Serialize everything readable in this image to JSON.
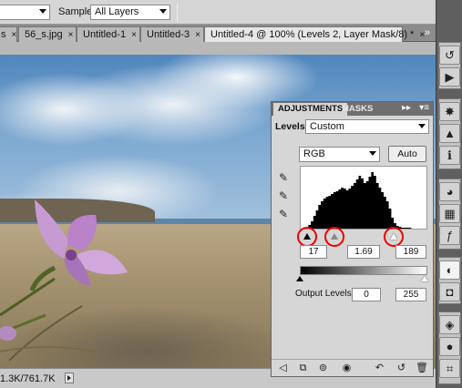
{
  "options_bar": {
    "sample_label": "Sample:",
    "sample_value": "All Layers"
  },
  "tabs": [
    {
      "label": "s",
      "active": false
    },
    {
      "label": "56_s.jpg",
      "active": false
    },
    {
      "label": "Untitled-1",
      "active": false
    },
    {
      "label": "Untitled-3",
      "active": false
    },
    {
      "label": "Untitled-4 @ 100% (Levels 2, Layer Mask/8) *",
      "active": true
    }
  ],
  "tab_more": "»",
  "status_bar": {
    "doc_size": "1.3K/761.7K"
  },
  "adjustments_panel": {
    "tabs": [
      "ADJUSTMENTS",
      "MASKS"
    ],
    "levels_label": "Levels",
    "preset_value": "Custom",
    "channel_value": "RGB",
    "auto_label": "Auto",
    "input_levels": {
      "black": "17",
      "gamma": "1.69",
      "white": "189"
    },
    "output_levels_label": "Output Levels:",
    "output_levels": {
      "black": "0",
      "white": "255"
    },
    "highlight_color": "#e00000"
  },
  "histogram": {
    "input_black_fraction": 0.067,
    "input_white_fraction": 0.741,
    "bins": [
      0,
      1,
      2,
      4,
      8,
      14,
      20,
      26,
      30,
      33,
      35,
      36,
      38,
      40,
      41,
      43,
      45,
      44,
      42,
      44,
      47,
      50,
      54,
      58,
      55,
      50,
      52,
      57,
      62,
      58,
      50,
      45,
      40,
      35,
      30,
      22,
      12,
      6,
      3,
      2,
      1,
      1,
      1,
      1,
      0,
      0,
      0,
      0,
      0,
      0
    ]
  },
  "right_toolbar": [
    "history-icon",
    "actions-icon",
    "navigator-icon",
    "histogram-icon",
    "info-icon",
    "color-icon",
    "swatches-icon",
    "styles-icon",
    "adjustments-icon",
    "masks-icon",
    "layers-icon",
    "channels-icon",
    "paths-icon"
  ]
}
